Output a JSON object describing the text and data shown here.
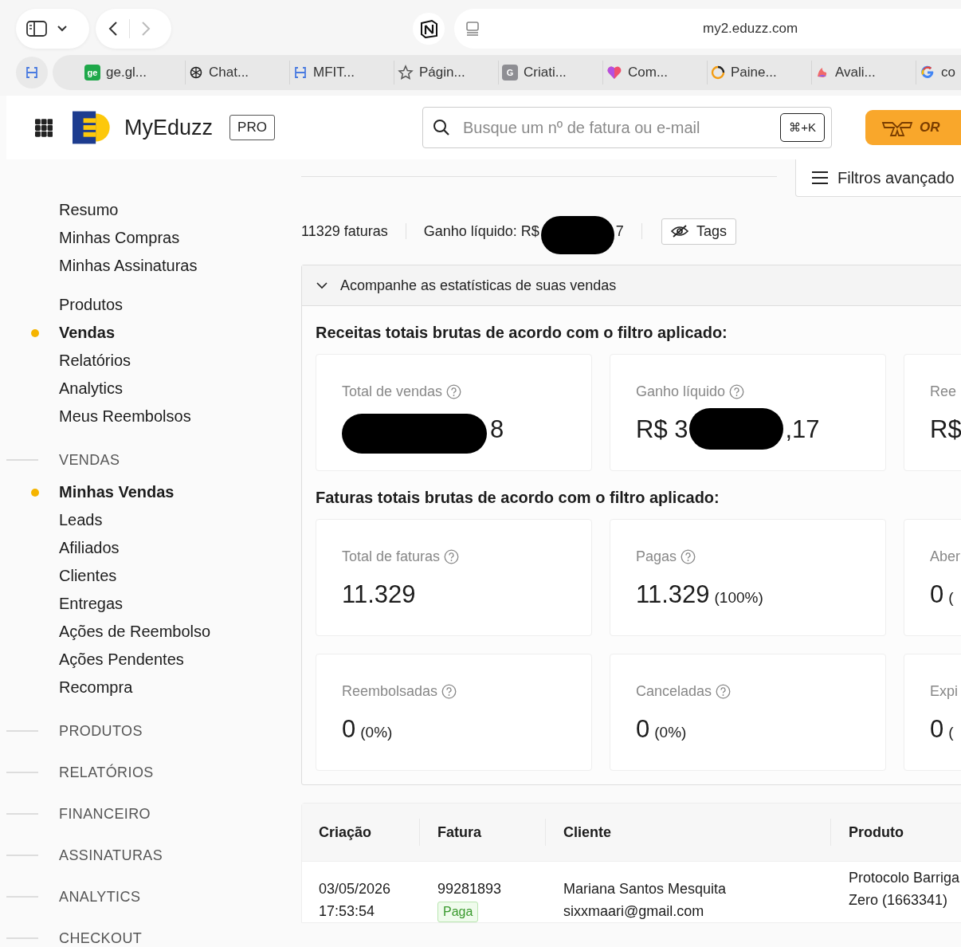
{
  "browser": {
    "url": "my2.eduzz.com",
    "tabs": [
      {
        "kind": "letter",
        "icon_text": "ge",
        "color": "#1fa84a",
        "title": "ge.gl..."
      },
      {
        "kind": "knot",
        "title": "Chat..."
      },
      {
        "kind": "bracket",
        "title": "MFIT..."
      },
      {
        "kind": "star",
        "title": "Págin..."
      },
      {
        "kind": "letter",
        "icon_text": "G",
        "color": "#8e8e93",
        "title": "Criati..."
      },
      {
        "kind": "heart",
        "title": "Com..."
      },
      {
        "kind": "ring",
        "title": "Paine..."
      },
      {
        "kind": "flame",
        "title": "Avali..."
      },
      {
        "kind": "google",
        "title": "co"
      }
    ]
  },
  "header": {
    "brand": "MyEduzz",
    "plan_badge": "PRO",
    "search": {
      "placeholder": "Busque um nº de fatura ou e-mail",
      "shortcut": "⌘+K"
    },
    "promo_button": "OR"
  },
  "sidebar": {
    "groups": [
      {
        "items": [
          {
            "label": "Resumo",
            "selected": false
          },
          {
            "label": "Minhas Compras",
            "selected": false
          },
          {
            "label": "Minhas Assinaturas",
            "selected": false
          }
        ]
      },
      {
        "items": [
          {
            "label": "Produtos",
            "selected": false
          },
          {
            "label": "Vendas",
            "selected": true
          },
          {
            "label": "Relatórios",
            "selected": false
          },
          {
            "label": "Analytics",
            "selected": false
          },
          {
            "label": "Meus Reembolsos",
            "selected": false
          }
        ]
      },
      {
        "heading": "VENDAS",
        "items": [
          {
            "label": "Minhas Vendas",
            "selected": true
          },
          {
            "label": "Leads",
            "selected": false
          },
          {
            "label": "Afiliados",
            "selected": false
          },
          {
            "label": "Clientes",
            "selected": false
          },
          {
            "label": "Entregas",
            "selected": false
          },
          {
            "label": "Ações de Reembolso",
            "selected": false
          },
          {
            "label": "Ações Pendentes",
            "selected": false
          },
          {
            "label": "Recompra",
            "selected": false
          }
        ]
      },
      {
        "heading": "PRODUTOS"
      },
      {
        "heading": "RELATÓRIOS"
      },
      {
        "heading": "FINANCEIRO"
      },
      {
        "heading": "ASSINATURAS"
      },
      {
        "heading": "ANALYTICS"
      },
      {
        "heading": "CHECKOUT"
      }
    ]
  },
  "filters_button": "Filtros avançado",
  "summary": {
    "invoice_count": "11329 faturas",
    "net_label": "Ganho líquido: R$",
    "net_suffix": "7",
    "tags_button": "Tags"
  },
  "stats": {
    "toggle": "Acompanhe as estatísticas de suas vendas",
    "sections": [
      {
        "title": "Receitas totais brutas de acordo com o filtro aplicado:",
        "cards": [
          {
            "kind": "redacted",
            "label": "Total de vendas",
            "help": true,
            "value_suffix": "8"
          },
          {
            "kind": "redacted",
            "label": "Ganho líquido",
            "help": true,
            "value_prefix": "R$ 3",
            "value_suffix": ",17"
          },
          {
            "kind": "plain",
            "label": "Ree",
            "help": false,
            "value": "R$"
          }
        ]
      },
      {
        "title": "Faturas totais brutas de acordo com o filtro aplicado:",
        "cards": [
          {
            "kind": "plain",
            "label": "Total de faturas",
            "help": true,
            "value": "11.329"
          },
          {
            "kind": "plain",
            "label": "Pagas",
            "help": true,
            "value": "11.329",
            "percent": "(100%)"
          },
          {
            "kind": "plain",
            "label": "Aber",
            "help": false,
            "value": "0",
            "percent": "("
          }
        ]
      },
      {
        "cards": [
          {
            "kind": "plain",
            "label": "Reembolsadas",
            "help": true,
            "value": "0",
            "percent": "(0%)"
          },
          {
            "kind": "plain",
            "label": "Canceladas",
            "help": true,
            "value": "0",
            "percent": "(0%)"
          },
          {
            "kind": "plain",
            "label": "Expi",
            "help": false,
            "value": "0",
            "percent": "("
          }
        ]
      }
    ]
  },
  "table": {
    "columns": [
      "Criação",
      "Fatura",
      "Cliente",
      "Produto"
    ],
    "rows": [
      {
        "date": "03/05/2026",
        "time": "17:53:54",
        "invoice": "99281893",
        "status": "Paga",
        "client_name": "Mariana Santos Mesquita",
        "client_email": "sixxmaari@gmail.com",
        "product": "Protocolo Barriga Zero (1663341)"
      }
    ]
  }
}
